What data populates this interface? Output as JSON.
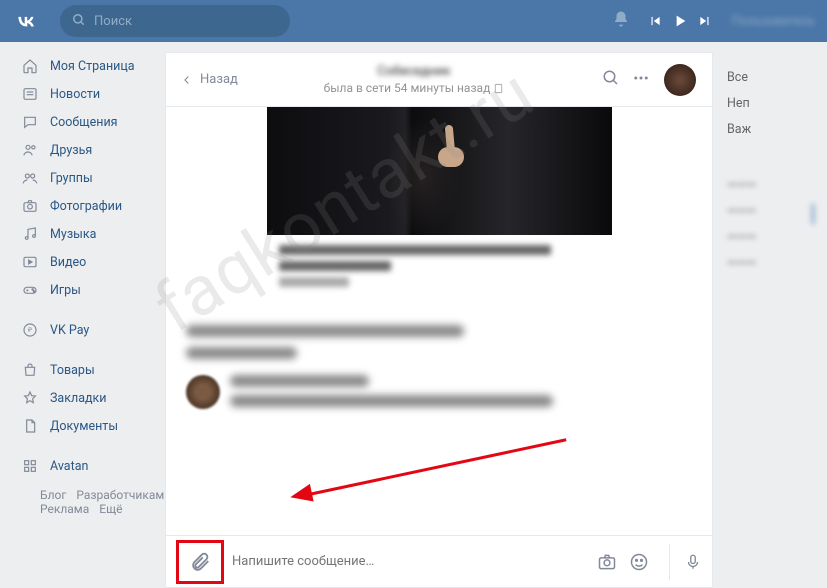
{
  "header": {
    "search_placeholder": "Поиск",
    "username": "Пользователь"
  },
  "sidebar": {
    "items": [
      {
        "label": "Моя Страница"
      },
      {
        "label": "Новости"
      },
      {
        "label": "Сообщения"
      },
      {
        "label": "Друзья"
      },
      {
        "label": "Группы"
      },
      {
        "label": "Фотографии"
      },
      {
        "label": "Музыка"
      },
      {
        "label": "Видео"
      },
      {
        "label": "Игры"
      }
    ],
    "vkpay": "VK Pay",
    "extra": [
      {
        "label": "Товары"
      },
      {
        "label": "Закладки"
      },
      {
        "label": "Документы"
      }
    ],
    "avatan": "Avatan",
    "footer": [
      "Блог",
      "Разработчикам",
      "Реклама",
      "Ещё"
    ]
  },
  "chat": {
    "back": "Назад",
    "name": "Собеседник",
    "status": "была в сети 54 минуты назад",
    "input_placeholder": "Напишите сообщение…"
  },
  "right": {
    "items": [
      "Все",
      "Непрочитанные",
      "Важные"
    ],
    "extra": [
      "",
      "",
      ""
    ]
  },
  "watermark": "faqkontakt.ru"
}
